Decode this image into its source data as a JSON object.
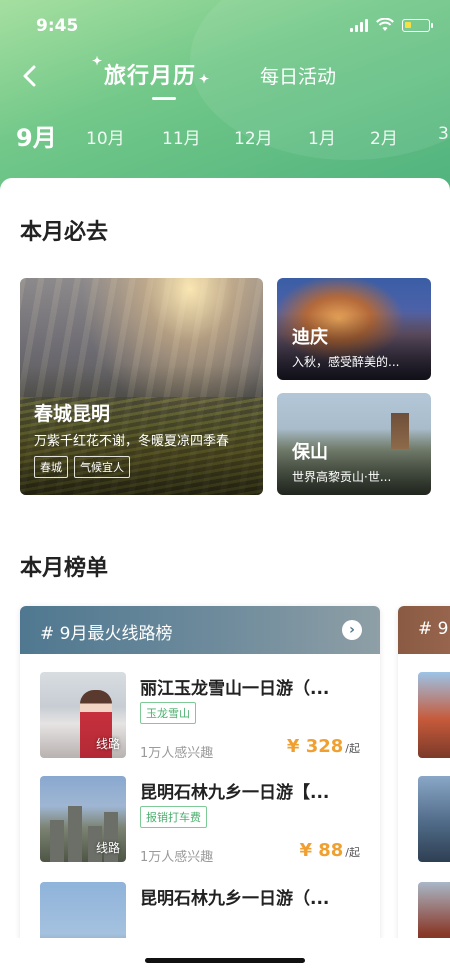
{
  "status_bar": {
    "time": "9:45"
  },
  "nav": {
    "active_tab": "旅行月历",
    "other_tab": "每日活动"
  },
  "months": [
    "9月",
    "10月",
    "11月",
    "12月",
    "1月",
    "2月",
    "3"
  ],
  "must_go": {
    "title": "本月必去",
    "featured": {
      "name": "春城昆明",
      "desc": "万紫千红花不谢，冬暖夏凉四季春",
      "tags": [
        "春城",
        "气候宜人"
      ]
    },
    "others": [
      {
        "name": "迪庆",
        "desc": "入秋，感受醉美的..."
      },
      {
        "name": "保山",
        "desc": "世界高黎贡山·世..."
      }
    ]
  },
  "ranking": {
    "title": "本月榜单",
    "list_title": "# 9月最火线路榜",
    "next_list_prefix": "# 9",
    "items": [
      {
        "name": "丽江玉龙雪山一日游（...",
        "tag": "玉龙雪山",
        "interest": "1万人感兴趣",
        "price": "¥ 328",
        "unit": "/起",
        "thumb_label": "线路"
      },
      {
        "name": "昆明石林九乡一日游【...",
        "tag": "报销打车费",
        "interest": "1万人感兴趣",
        "price": "¥ 88",
        "unit": "/起",
        "thumb_label": "线路"
      },
      {
        "name": "昆明石林九乡一日游（...",
        "tag": "",
        "interest": "",
        "price": "",
        "unit": "",
        "thumb_label": ""
      }
    ]
  },
  "icons": {
    "back": "chevron-left-icon",
    "list_arrow": "chevron-right-icon"
  },
  "colors": {
    "header_green": "#4fb27d",
    "price_orange": "#f0a030",
    "tag_green": "#4caf6e"
  }
}
